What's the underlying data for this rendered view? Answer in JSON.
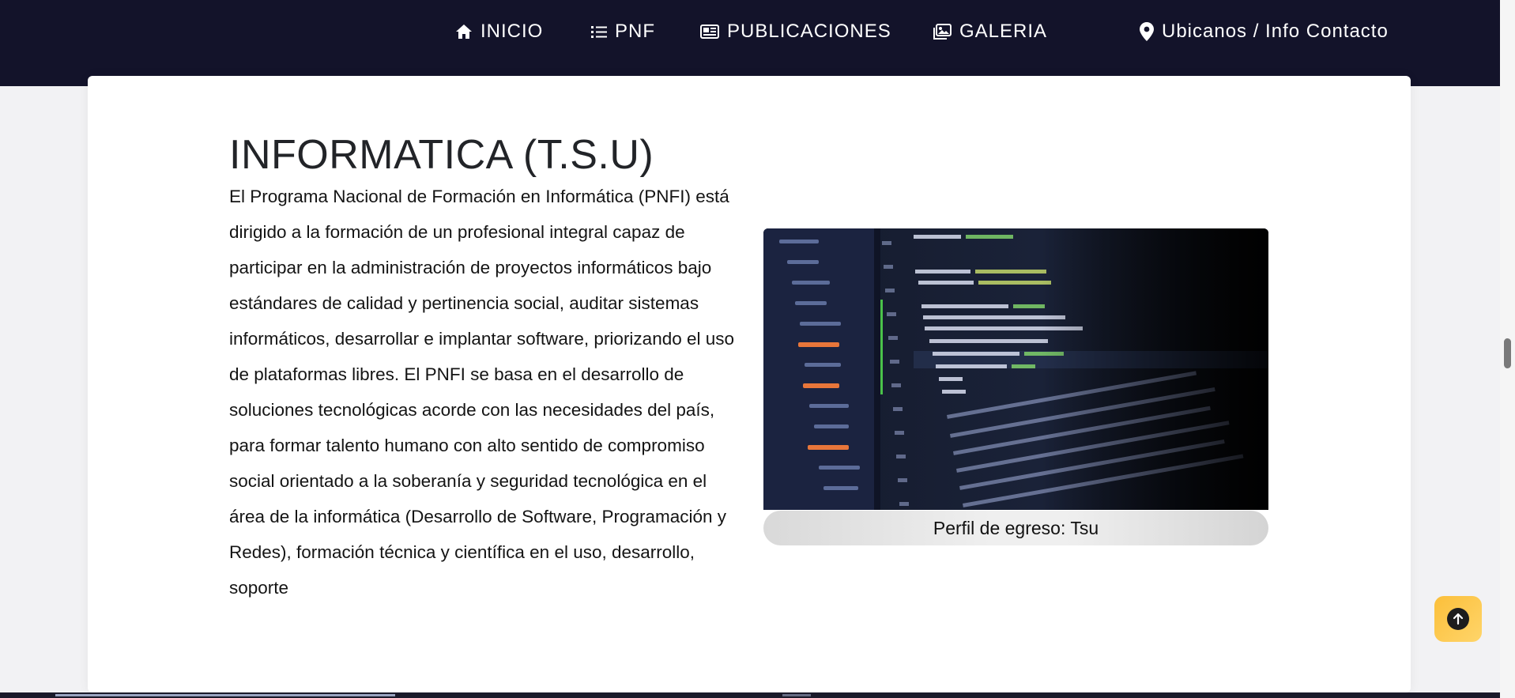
{
  "nav": {
    "items": [
      {
        "label": "INICIO",
        "icon": "home-icon"
      },
      {
        "label": "PNF",
        "icon": "list-icon"
      },
      {
        "label": "PUBLICACIONES",
        "icon": "newspaper-icon"
      },
      {
        "label": "GALERIA",
        "icon": "images-icon"
      },
      {
        "label": "Ubicanos / Info Contacto",
        "icon": "location-pin-icon"
      }
    ]
  },
  "program": {
    "title": "INFORMATICA (T.S.U)",
    "description": "El Programa Nacional de Formación en Informática (PNFI) está dirigido a la formación de un profesional integral capaz de participar en la administración de proyectos informáticos bajo estándares de calidad y pertinencia social, auditar sistemas informáticos, desarrollar e implantar software, priorizando el uso de plataformas libres. El PNFI se basa en el desarrollo de soluciones tecnológicas acorde con las necesidades del país, para formar talento humano con alto sentido de compromiso social orientado a la soberanía y seguridad tecnológica en el área de la informática (Desarrollo de Software, Programación y Redes), formación técnica y científica en el uso, desarrollo, soporte",
    "image_caption": "Perfil de egreso: Tsu"
  },
  "colors": {
    "navbar": "#13132a",
    "scroll_button": "#fbbf3a"
  }
}
